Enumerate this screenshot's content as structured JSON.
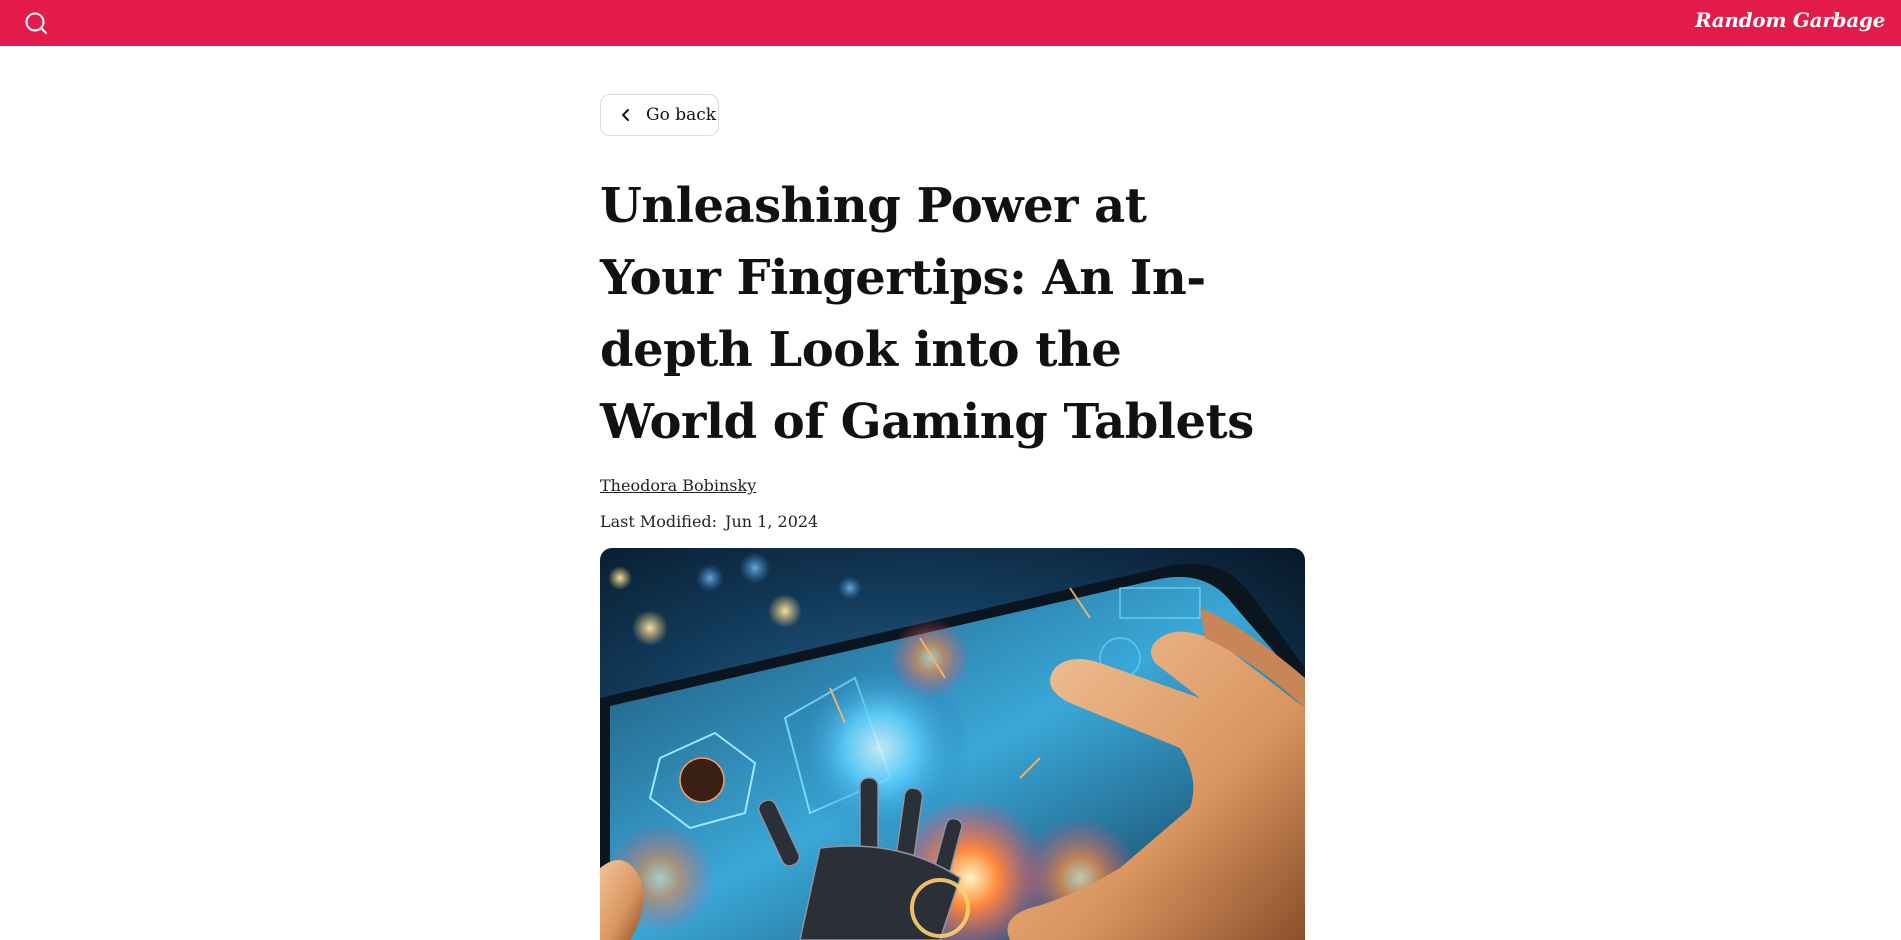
{
  "header": {
    "brand": "Random Garbage",
    "search_icon": "search-icon",
    "bg_color": "#e31b4b"
  },
  "article": {
    "back_label": "Go back",
    "back_icon": "chevron-left-icon",
    "title": "Unleashing Power at Your Fingertips: An In-depth Look into the World of Gaming Tablets",
    "author": "Theodora Bobinsky",
    "modified_label": "Last Modified:",
    "modified_date": "Jun 1, 2024"
  }
}
